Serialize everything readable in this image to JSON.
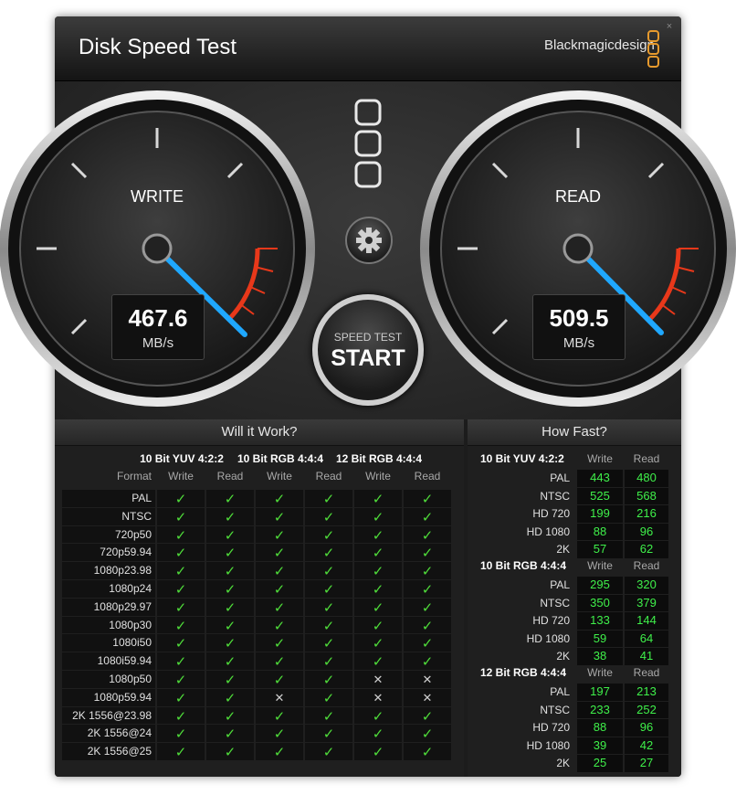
{
  "app": {
    "title": "Disk Speed Test",
    "brand": "Blackmagicdesign",
    "close_symbol": "×"
  },
  "gauges": {
    "write": {
      "label": "WRITE",
      "value": "467.6",
      "unit": "MB/s"
    },
    "read": {
      "label": "READ",
      "value": "509.5",
      "unit": "MB/s"
    }
  },
  "controls": {
    "start_line1": "SPEED TEST",
    "start_line2": "START",
    "settings_icon": "gear-icon"
  },
  "will_it_work": {
    "title": "Will it Work?",
    "format_header": "Format",
    "groups": [
      "10 Bit YUV 4:2:2",
      "10 Bit RGB 4:4:4",
      "12 Bit RGB 4:4:4"
    ],
    "subheaders": [
      "Write",
      "Read"
    ],
    "rows": [
      {
        "format": "PAL",
        "cells": [
          1,
          1,
          1,
          1,
          1,
          1
        ]
      },
      {
        "format": "NTSC",
        "cells": [
          1,
          1,
          1,
          1,
          1,
          1
        ]
      },
      {
        "format": "720p50",
        "cells": [
          1,
          1,
          1,
          1,
          1,
          1
        ]
      },
      {
        "format": "720p59.94",
        "cells": [
          1,
          1,
          1,
          1,
          1,
          1
        ]
      },
      {
        "format": "1080p23.98",
        "cells": [
          1,
          1,
          1,
          1,
          1,
          1
        ]
      },
      {
        "format": "1080p24",
        "cells": [
          1,
          1,
          1,
          1,
          1,
          1
        ]
      },
      {
        "format": "1080p29.97",
        "cells": [
          1,
          1,
          1,
          1,
          1,
          1
        ]
      },
      {
        "format": "1080p30",
        "cells": [
          1,
          1,
          1,
          1,
          1,
          1
        ]
      },
      {
        "format": "1080i50",
        "cells": [
          1,
          1,
          1,
          1,
          1,
          1
        ]
      },
      {
        "format": "1080i59.94",
        "cells": [
          1,
          1,
          1,
          1,
          1,
          1
        ]
      },
      {
        "format": "1080p50",
        "cells": [
          1,
          1,
          1,
          1,
          0,
          0
        ]
      },
      {
        "format": "1080p59.94",
        "cells": [
          1,
          1,
          0,
          1,
          0,
          0
        ]
      },
      {
        "format": "2K 1556@23.98",
        "cells": [
          1,
          1,
          1,
          1,
          1,
          1
        ]
      },
      {
        "format": "2K 1556@24",
        "cells": [
          1,
          1,
          1,
          1,
          1,
          1
        ]
      },
      {
        "format": "2K 1556@25",
        "cells": [
          1,
          1,
          1,
          1,
          1,
          1
        ]
      }
    ]
  },
  "how_fast": {
    "title": "How Fast?",
    "subheaders": [
      "Write",
      "Read"
    ],
    "groups": [
      {
        "name": "10 Bit YUV 4:2:2",
        "rows": [
          {
            "format": "PAL",
            "write": "443",
            "read": "480"
          },
          {
            "format": "NTSC",
            "write": "525",
            "read": "568"
          },
          {
            "format": "HD 720",
            "write": "199",
            "read": "216"
          },
          {
            "format": "HD 1080",
            "write": "88",
            "read": "96"
          },
          {
            "format": "2K",
            "write": "57",
            "read": "62"
          }
        ]
      },
      {
        "name": "10 Bit RGB 4:4:4",
        "rows": [
          {
            "format": "PAL",
            "write": "295",
            "read": "320"
          },
          {
            "format": "NTSC",
            "write": "350",
            "read": "379"
          },
          {
            "format": "HD 720",
            "write": "133",
            "read": "144"
          },
          {
            "format": "HD 1080",
            "write": "59",
            "read": "64"
          },
          {
            "format": "2K",
            "write": "38",
            "read": "41"
          }
        ]
      },
      {
        "name": "12 Bit RGB 4:4:4",
        "rows": [
          {
            "format": "PAL",
            "write": "197",
            "read": "213"
          },
          {
            "format": "NTSC",
            "write": "233",
            "read": "252"
          },
          {
            "format": "HD 720",
            "write": "88",
            "read": "96"
          },
          {
            "format": "HD 1080",
            "write": "39",
            "read": "42"
          },
          {
            "format": "2K",
            "write": "25",
            "read": "27"
          }
        ]
      }
    ]
  },
  "icons": {
    "check": "✓",
    "cross": "✕"
  },
  "colors": {
    "accent_needle": "#1fa8ff",
    "check_green": "#4fdc3a",
    "value_green": "#3ff04a",
    "redline": "#e8381a",
    "logo_orange": "#e79a2d"
  }
}
